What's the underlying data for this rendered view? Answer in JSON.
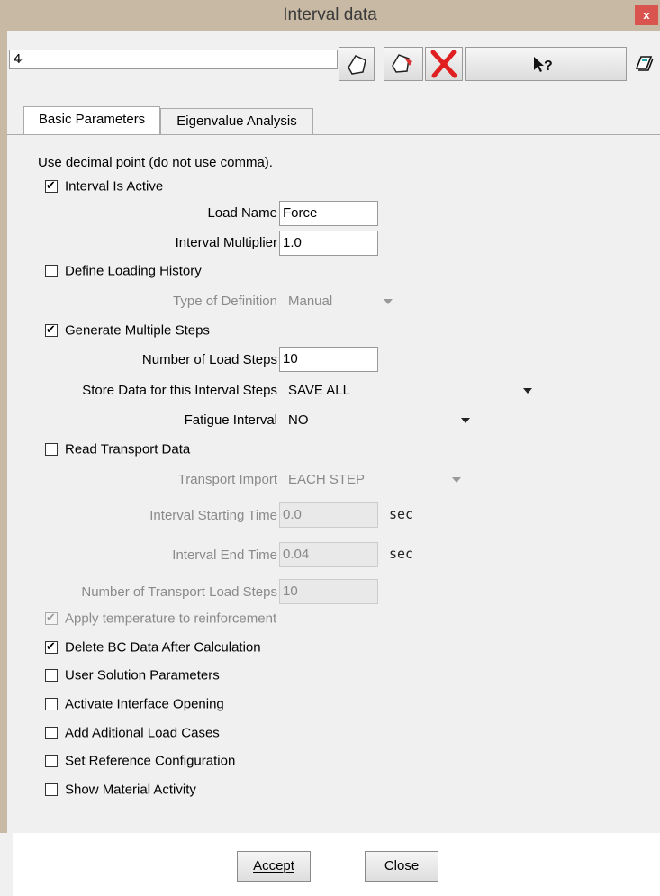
{
  "window": {
    "title": "Interval data",
    "close_glyph": "x"
  },
  "toolbar": {
    "interval_selector": {
      "value": "4"
    },
    "icons": [
      "new-document-icon",
      "copy-document-icon",
      "delete-x-icon",
      "context-help-icon",
      "book-icon"
    ]
  },
  "tabs": [
    {
      "label": "Basic Parameters",
      "active": true
    },
    {
      "label": "Eigenvalue Analysis",
      "active": false
    }
  ],
  "form": {
    "note": "Use decimal point (do not use comma).",
    "interval_active": {
      "label": "Interval Is Active",
      "checked": true
    },
    "load_name": {
      "label": "Load Name",
      "value": "Force"
    },
    "interval_multiplier": {
      "label": "Interval Multiplier",
      "value": "1.0"
    },
    "define_loading_history": {
      "label": "Define Loading History",
      "checked": false
    },
    "type_of_definition": {
      "label": "Type of Definition",
      "value": "Manual"
    },
    "generate_multiple_steps": {
      "label": "Generate Multiple Steps",
      "checked": true
    },
    "number_of_load_steps": {
      "label": "Number of Load Steps",
      "value": "10"
    },
    "store_data": {
      "label": "Store Data for this Interval Steps",
      "value": "SAVE ALL"
    },
    "fatigue_interval": {
      "label": "Fatigue Interval",
      "value": "NO"
    },
    "read_transport_data": {
      "label": "Read Transport Data",
      "checked": false
    },
    "transport_import": {
      "label": "Transport Import",
      "value": "EACH STEP"
    },
    "interval_starting_time": {
      "label": "Interval Starting Time",
      "value": "0.0",
      "unit": "sec"
    },
    "interval_end_time": {
      "label": "Interval End Time",
      "value": "0.04",
      "unit": "sec"
    },
    "number_of_transport_load_steps": {
      "label": "Number of Transport Load Steps",
      "value": "10"
    },
    "apply_temperature": {
      "label": "Apply temperature to reinforcement",
      "checked": true,
      "disabled": true
    },
    "delete_bc_data": {
      "label": "Delete BC Data After Calculation",
      "checked": true
    },
    "user_solution_parameters": {
      "label": "User Solution Parameters",
      "checked": false
    },
    "activate_interface_opening": {
      "label": "Activate Interface Opening",
      "checked": false
    },
    "add_additional_load_cases": {
      "label": "Add Aditional Load Cases",
      "checked": false
    },
    "set_reference_configuration": {
      "label": "Set Reference Configuration",
      "checked": false
    },
    "show_material_activity": {
      "label": "Show Material Activity",
      "checked": false
    }
  },
  "buttons": {
    "accept": "Accept",
    "close": "Close"
  },
  "colors": {
    "titlebar": "#c8b9a4",
    "close_button": "#d9534f",
    "delete_icon": "#e02020"
  }
}
